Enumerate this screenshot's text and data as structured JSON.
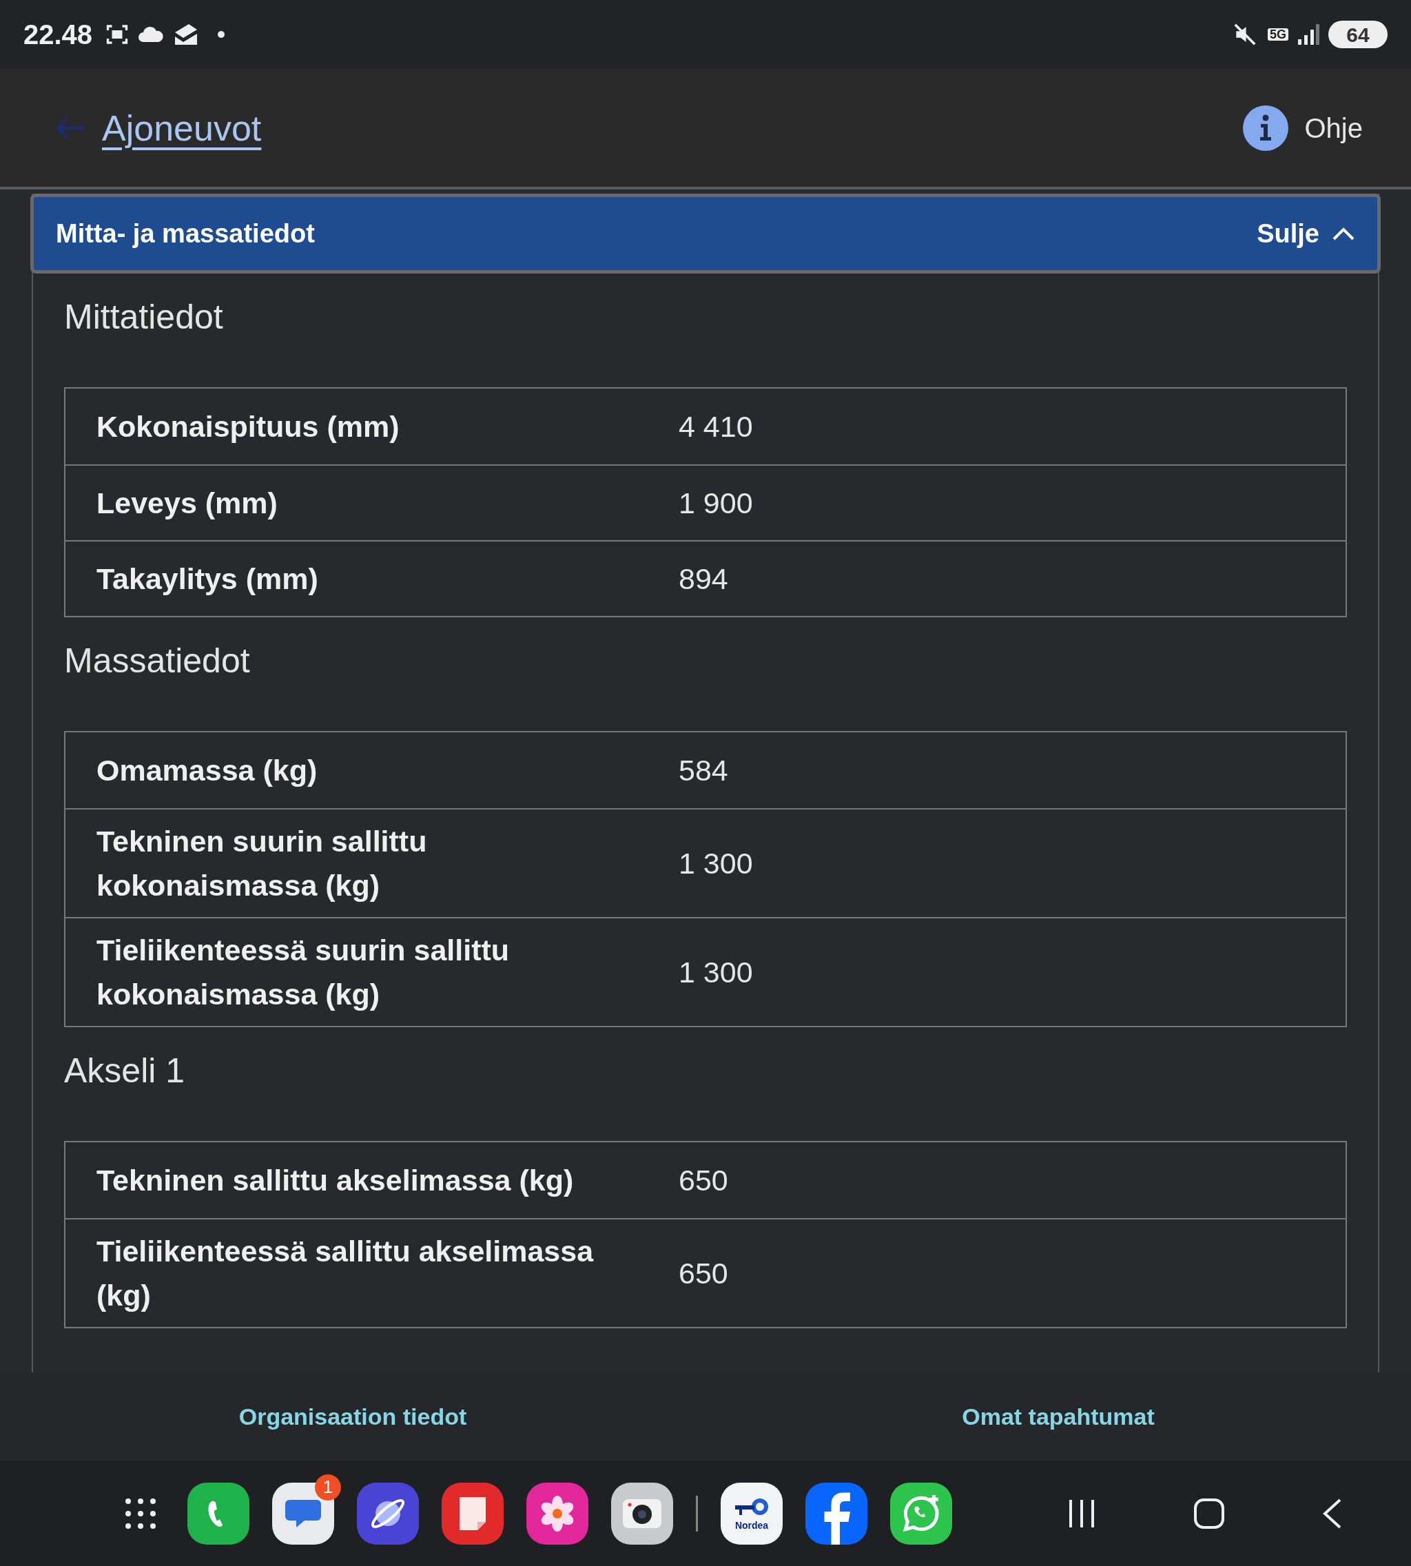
{
  "status_bar": {
    "time": "22.48",
    "network": "5G",
    "battery": "64"
  },
  "header": {
    "back_link": "Ajoneuvot",
    "help": "Ohje"
  },
  "section": {
    "title": "Mitta- ja massatiedot",
    "toggle": "Sulje",
    "expanded": true,
    "groups": [
      {
        "heading": "Mittatiedot",
        "rows": [
          {
            "label": "Kokonaispituus (mm)",
            "value": "4 410"
          },
          {
            "label": "Leveys (mm)",
            "value": "1 900"
          },
          {
            "label": "Takaylitys (mm)",
            "value": "894"
          }
        ]
      },
      {
        "heading": "Massatiedot",
        "rows": [
          {
            "label": "Omamassa (kg)",
            "value": "584"
          },
          {
            "label": "Tekninen suurin sallittu kokonaismassa (kg)",
            "value": "1 300"
          },
          {
            "label": "Tieliikenteessä suurin sallittu kokonaismassa (kg)",
            "value": "1 300"
          }
        ]
      },
      {
        "heading": "Akseli 1",
        "rows": [
          {
            "label": "Tekninen sallittu akselimassa (kg)",
            "value": "650"
          },
          {
            "label": "Tieliikenteessä sallittu akselimassa (kg)",
            "value": "650"
          }
        ]
      }
    ]
  },
  "bottom_nav": [
    "Organisaation tiedot",
    "Omat tapahtumat"
  ],
  "dock": {
    "apps": [
      {
        "kind": "phone"
      },
      {
        "kind": "messages",
        "badge": "1"
      },
      {
        "kind": "browser"
      },
      {
        "kind": "notes"
      },
      {
        "kind": "gallery"
      },
      {
        "kind": "camera"
      },
      {
        "kind": "nordea",
        "label": "Nordea"
      },
      {
        "kind": "facebook"
      },
      {
        "kind": "whatsapp"
      }
    ]
  }
}
